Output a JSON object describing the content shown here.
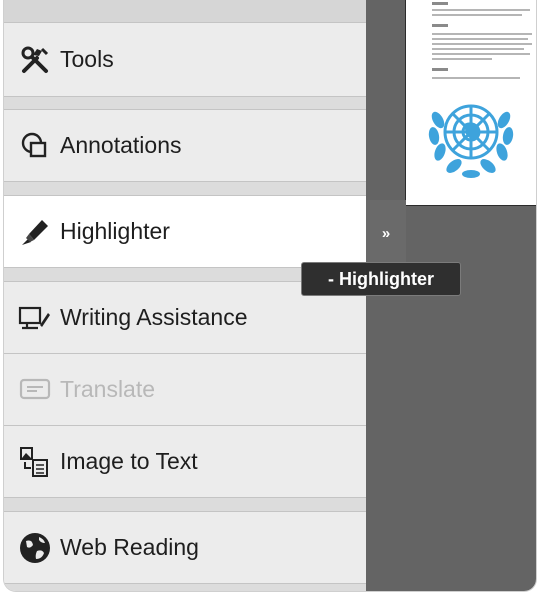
{
  "sidebar": {
    "items": [
      {
        "label": "Tools",
        "icon": "tools-icon",
        "state": "normal"
      },
      {
        "label": "Annotations",
        "icon": "annotations-icon",
        "state": "normal"
      },
      {
        "label": "Highlighter",
        "icon": "highlighter-icon",
        "state": "active"
      },
      {
        "label": "Writing Assistance",
        "icon": "writing-assistance-icon",
        "state": "normal"
      },
      {
        "label": "Translate",
        "icon": "translate-icon",
        "state": "disabled"
      },
      {
        "label": "Image to Text",
        "icon": "image-to-text-icon",
        "state": "normal"
      },
      {
        "label": "Web Reading",
        "icon": "web-reading-icon",
        "state": "normal"
      }
    ]
  },
  "collapse_button": {
    "label": "»"
  },
  "tooltip": {
    "text": "- Highlighter"
  },
  "document_preview": {
    "emblem": "un-emblem-icon"
  },
  "colors": {
    "emblem": "#3ea3dc",
    "panel_bg": "#646464",
    "active_bg": "#ffffff"
  }
}
